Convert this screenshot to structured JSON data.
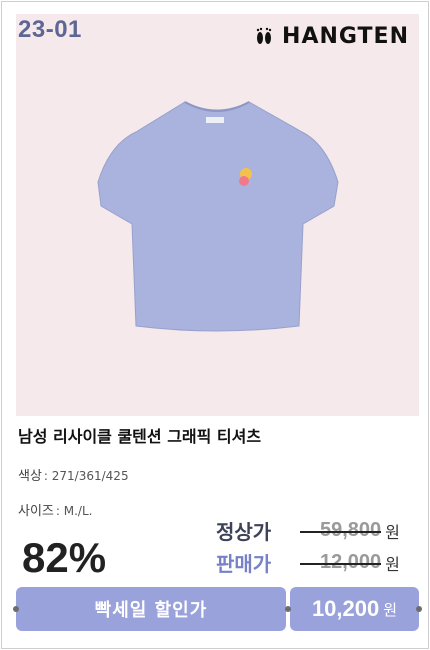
{
  "product": {
    "code": "23-01",
    "brand": "HANGTEN",
    "title": "남성 리사이클 쿨텐션 그래픽 티셔츠",
    "color_label": "색상",
    "color_value": ": 271/361/425",
    "size_label": "사이즈",
    "size_value": ": M./L.",
    "discount": "82%",
    "regular_label": "정상가",
    "regular_price": "59,800",
    "sale_label": "판매가",
    "sale_price": "12,000",
    "won": "원",
    "promo_label": "빡세일 할인가",
    "promo_price": "10,200"
  },
  "colors": {
    "shirt": "#a9b3dd",
    "accent": "#9aa2dc",
    "code": "#5d6694",
    "hero_bg": "#f5e9ec"
  },
  "icons": {
    "brand": "footprints-icon"
  }
}
